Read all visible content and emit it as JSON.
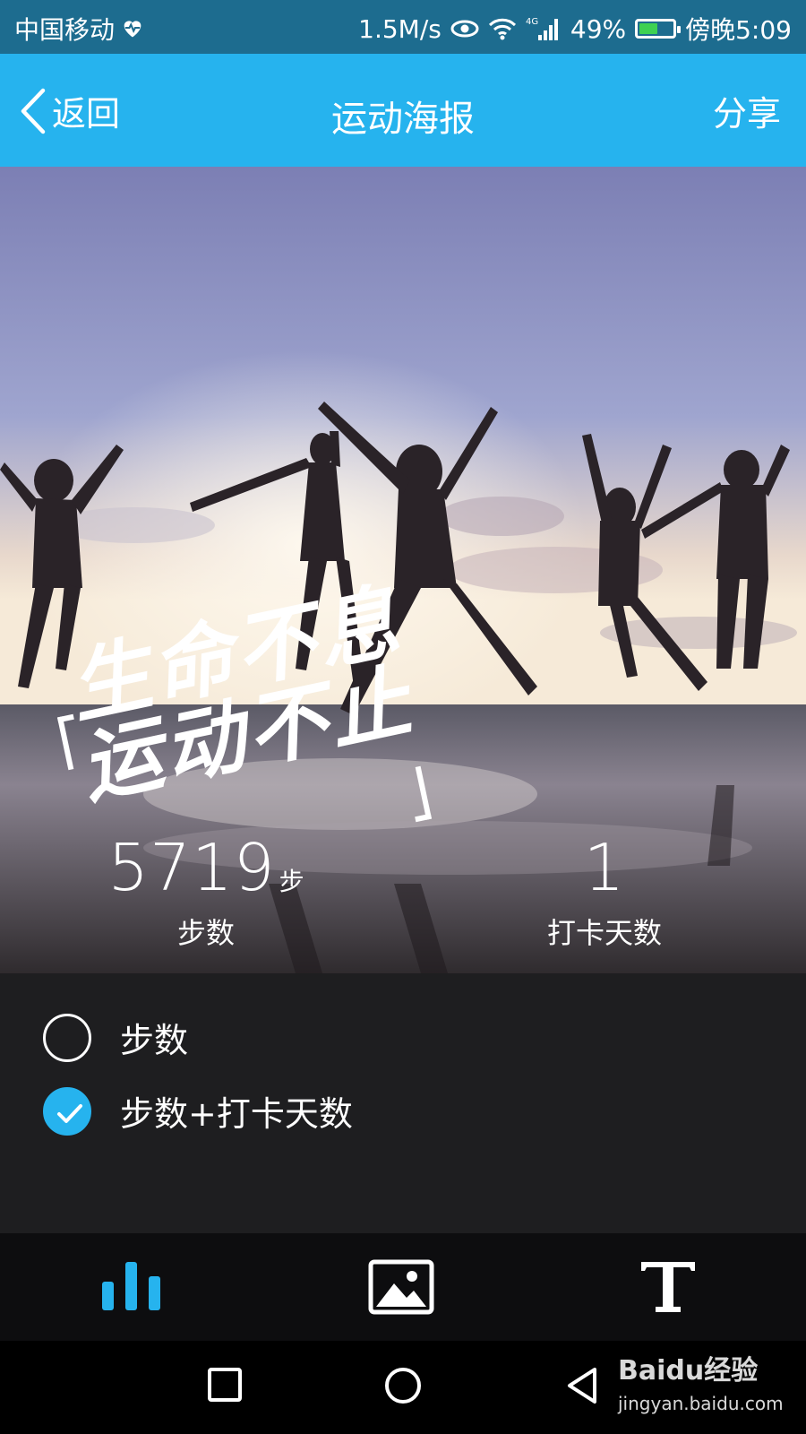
{
  "status_bar": {
    "carrier": "中国移动",
    "speed": "1.5M/s",
    "network": "4G",
    "battery_percent": "49%",
    "battery_level": 0.49,
    "time": "傍晚5:09"
  },
  "app_bar": {
    "back_label": "返回",
    "title": "运动海报",
    "share_label": "分享"
  },
  "poster": {
    "slogan_line1": "生命不息",
    "slogan_line2": "运动不止",
    "steps_value": "5719",
    "steps_unit": "步",
    "steps_label": "步数",
    "days_value": "1",
    "days_label": "打卡天数"
  },
  "options": [
    {
      "label": "步数",
      "selected": false
    },
    {
      "label": "步数+打卡天数",
      "selected": true
    }
  ],
  "toolbar": {
    "items": [
      "chart-icon",
      "image-icon",
      "text-icon"
    ],
    "active": "chart-icon"
  },
  "colors": {
    "accent": "#26b3ee",
    "status_bar": "#1d6c8f",
    "panel": "#1e1e20"
  },
  "watermark": {
    "brand": "Baidu经验",
    "url": "jingyan.baidu.com"
  }
}
